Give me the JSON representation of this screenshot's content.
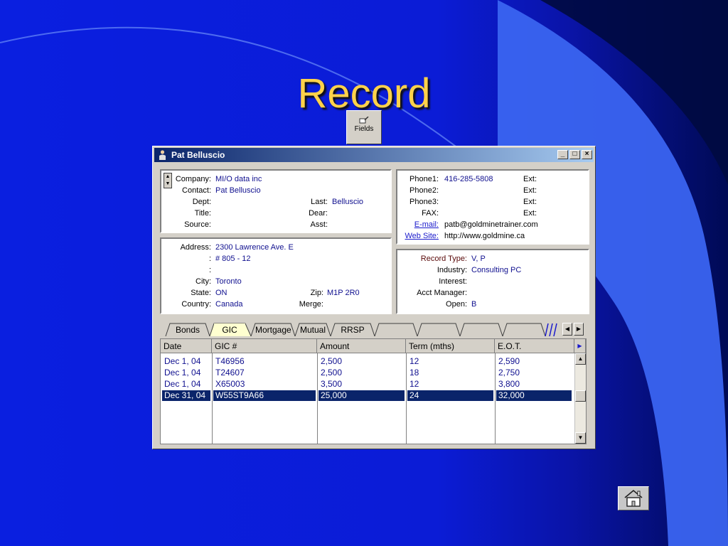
{
  "slide": {
    "title": "Record"
  },
  "toolbar": {
    "fields_label": "Fields",
    "fields_icon": "fields-icon"
  },
  "window": {
    "title": "Pat Belluscio",
    "buttons": {
      "minimize": "_",
      "maximize": "□",
      "close": "×"
    }
  },
  "contact": {
    "company_label": "Company:",
    "company": "MI/O data inc",
    "contact_label": "Contact:",
    "contact": "Pat Belluscio",
    "dept_label": "Dept:",
    "dept": "",
    "last_label": "Last:",
    "last": "Belluscio",
    "title_label": "Title:",
    "title": "",
    "dear_label": "Dear:",
    "dear": "",
    "source_label": "Source:",
    "source": "",
    "asst_label": "Asst:",
    "asst": ""
  },
  "phones": {
    "phone1_label": "Phone1:",
    "phone1": "416-285-5808",
    "ext1_label": "Ext:",
    "phone2_label": "Phone2:",
    "phone2": "",
    "ext2_label": "Ext:",
    "phone3_label": "Phone3:",
    "phone3": "",
    "ext3_label": "Ext:",
    "fax_label": "FAX:",
    "fax": "",
    "ext4_label": "Ext:",
    "email_label": "E-mail:",
    "email": "patb@goldminetrainer.com",
    "web_label": "Web Site:",
    "web": "http://www.goldmine.ca"
  },
  "address": {
    "address_label": "Address:",
    "address1": "2300 Lawrence Ave. E",
    "colon2": ":",
    "address2": "# 805  - 12",
    "colon3": ":",
    "address3": "",
    "city_label": "City:",
    "city": "Toronto",
    "state_label": "State:",
    "state": "ON",
    "zip_label": "Zip:",
    "zip": "M1P 2R0",
    "country_label": "Country:",
    "country": "Canada",
    "merge_label": "Merge:",
    "merge": ""
  },
  "record_info": {
    "type_label": "Record Type:",
    "type": "V, P",
    "industry_label": "Industry:",
    "industry": "Consulting PC",
    "interest_label": "Interest:",
    "interest": "",
    "manager_label": "Acct Manager:",
    "manager": "",
    "open_label": "Open:",
    "open": "B"
  },
  "tabs": [
    "Bonds",
    "GIC",
    "Mortgage",
    "Mutual",
    "RRSP"
  ],
  "active_tab": "GIC",
  "table": {
    "headers": [
      "Date",
      "GIC #",
      "Amount",
      "Term (mths)",
      "E.O.T."
    ],
    "rows": [
      [
        "Dec 1, 04",
        "T46956",
        "2,500",
        "12",
        "2,590"
      ],
      [
        "Dec 1, 04",
        "T24607",
        "2,500",
        "18",
        "2,750"
      ],
      [
        "Dec 1, 04",
        "X65003",
        "3,500",
        "12",
        "3,800"
      ],
      [
        "Dec 31, 04",
        "W55ST9A66",
        "25,000",
        "24",
        "32,000"
      ]
    ],
    "selected_row": 3
  },
  "nav": {
    "home_icon": "home-icon"
  },
  "colors": {
    "title": "#ffd24a",
    "selection": "#0a246a",
    "value_text": "#10108f"
  }
}
